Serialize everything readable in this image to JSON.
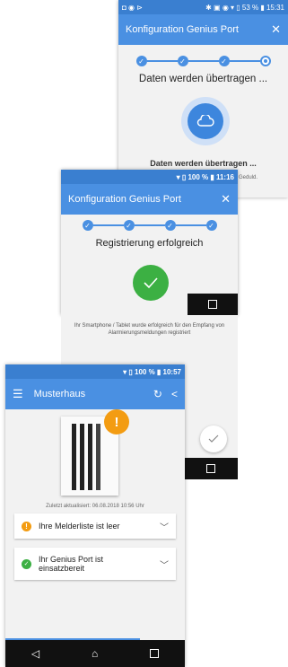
{
  "screen1": {
    "status": {
      "left": "◘ ◉ ⊳",
      "right": "✱ ▣ ◉ ▾ ▯ 53 % ▮ 15:31"
    },
    "title": "Konfiguration Genius Port",
    "heading": "Daten werden übertragen ...",
    "subheading": "Daten werden übertragen ...",
    "note": "Geduld."
  },
  "screen2": {
    "status": {
      "right": "▾ ▯ 100 % ▮ 11:16"
    },
    "title": "Konfiguration Genius Port",
    "heading": "Registrierung erfolgreich",
    "message": "Ihr Smartphone / Tablet wurde erfolgreich für den Empfang von Alarmierungsmeldungen registriert"
  },
  "screen3": {
    "status": {
      "right": "▾ ▯ 100 % ▮ 10:57"
    },
    "title": "Musterhaus",
    "last_updated": "Zuletzt aktualisiert: 06.08.2018 10:56 Uhr",
    "items": [
      {
        "label": "Ihre Melderliste ist leer",
        "status": "warning"
      },
      {
        "label": "Ihr Genius Port ist einsatzbereit",
        "status": "ok"
      }
    ]
  },
  "colors": {
    "brand": "#4a90e2",
    "success": "#3cb043",
    "warning": "#f39c12"
  }
}
